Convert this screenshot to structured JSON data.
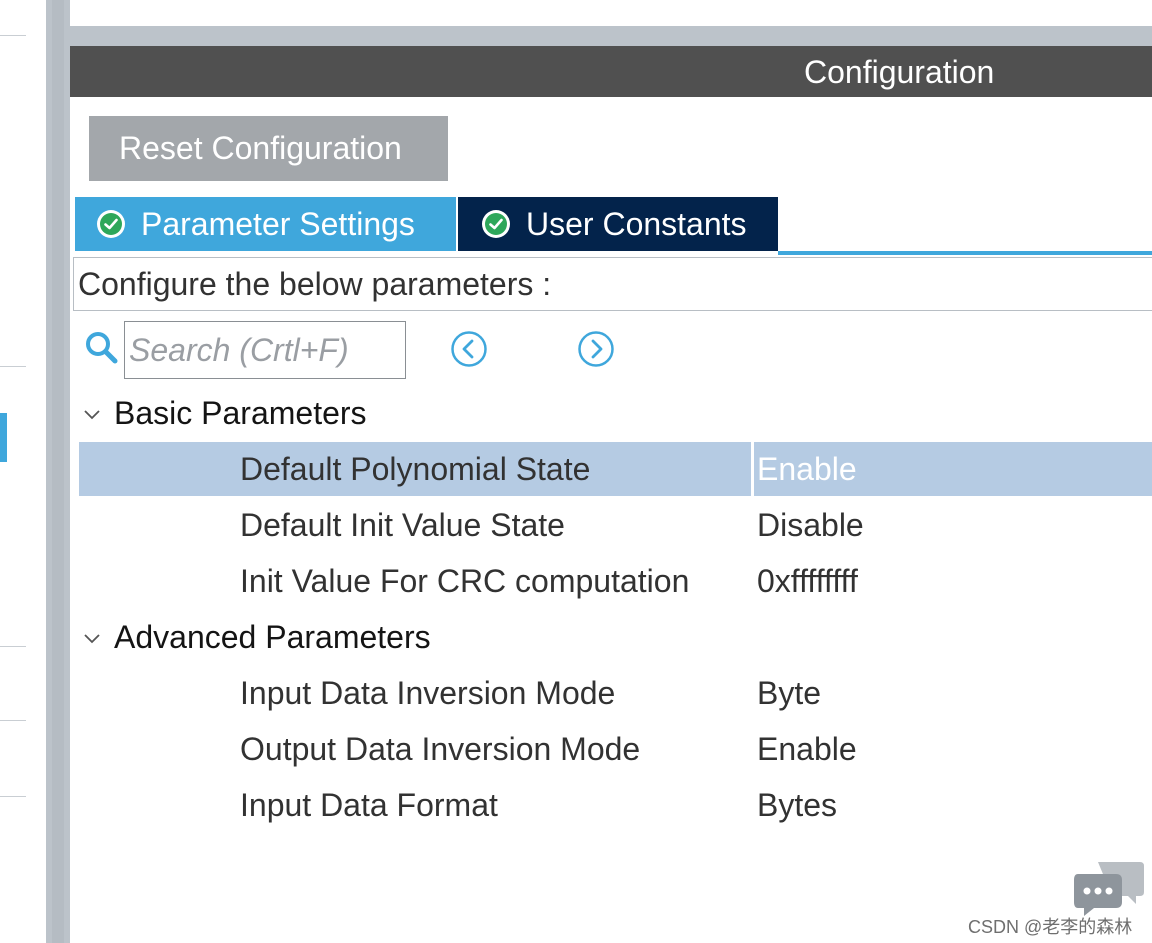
{
  "header": {
    "title": "Configuration"
  },
  "toolbar": {
    "reset_label": "Reset Configuration"
  },
  "tabs": [
    {
      "label": "Parameter Settings",
      "active": true,
      "icon": "check-circle-icon"
    },
    {
      "label": "User Constants",
      "active": false,
      "icon": "check-circle-icon"
    }
  ],
  "description": "Configure the below parameters :",
  "search": {
    "placeholder": "Search (Crtl+F)",
    "value": ""
  },
  "groups": [
    {
      "title": "Basic Parameters",
      "expanded": true,
      "rows": [
        {
          "label": "Default Polynomial State",
          "value": "Enable",
          "selected": true
        },
        {
          "label": "Default Init Value State",
          "value": "Disable",
          "selected": false
        },
        {
          "label": "Init Value For CRC computation",
          "value": "0xffffffff",
          "selected": false
        }
      ]
    },
    {
      "title": "Advanced Parameters",
      "expanded": true,
      "rows": [
        {
          "label": "Input Data Inversion Mode",
          "value": "Byte",
          "selected": false
        },
        {
          "label": "Output Data Inversion Mode",
          "value": "Enable",
          "selected": false
        },
        {
          "label": "Input Data Format",
          "value": "Bytes",
          "selected": false
        }
      ]
    }
  ],
  "watermark": "CSDN @老李的森林",
  "colors": {
    "header_bg": "#505050",
    "tab_active": "#3fa7dc",
    "tab_inactive": "#03234b",
    "check_green": "#2ea75a",
    "selected_row": "#b5cbe3",
    "reset_button": "#a3a7ab"
  }
}
